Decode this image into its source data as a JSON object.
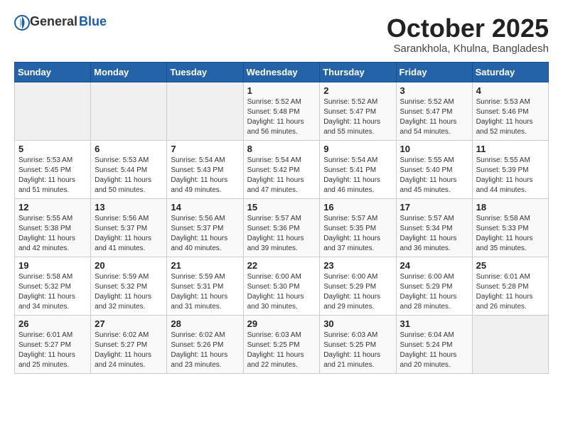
{
  "header": {
    "logo_general": "General",
    "logo_blue": "Blue",
    "month_title": "October 2025",
    "subtitle": "Sarankhola, Khulna, Bangladesh"
  },
  "weekdays": [
    "Sunday",
    "Monday",
    "Tuesday",
    "Wednesday",
    "Thursday",
    "Friday",
    "Saturday"
  ],
  "weeks": [
    [
      {
        "day": "",
        "content": ""
      },
      {
        "day": "",
        "content": ""
      },
      {
        "day": "",
        "content": ""
      },
      {
        "day": "1",
        "content": "Sunrise: 5:52 AM\nSunset: 5:48 PM\nDaylight: 11 hours\nand 56 minutes."
      },
      {
        "day": "2",
        "content": "Sunrise: 5:52 AM\nSunset: 5:47 PM\nDaylight: 11 hours\nand 55 minutes."
      },
      {
        "day": "3",
        "content": "Sunrise: 5:52 AM\nSunset: 5:47 PM\nDaylight: 11 hours\nand 54 minutes."
      },
      {
        "day": "4",
        "content": "Sunrise: 5:53 AM\nSunset: 5:46 PM\nDaylight: 11 hours\nand 52 minutes."
      }
    ],
    [
      {
        "day": "5",
        "content": "Sunrise: 5:53 AM\nSunset: 5:45 PM\nDaylight: 11 hours\nand 51 minutes."
      },
      {
        "day": "6",
        "content": "Sunrise: 5:53 AM\nSunset: 5:44 PM\nDaylight: 11 hours\nand 50 minutes."
      },
      {
        "day": "7",
        "content": "Sunrise: 5:54 AM\nSunset: 5:43 PM\nDaylight: 11 hours\nand 49 minutes."
      },
      {
        "day": "8",
        "content": "Sunrise: 5:54 AM\nSunset: 5:42 PM\nDaylight: 11 hours\nand 47 minutes."
      },
      {
        "day": "9",
        "content": "Sunrise: 5:54 AM\nSunset: 5:41 PM\nDaylight: 11 hours\nand 46 minutes."
      },
      {
        "day": "10",
        "content": "Sunrise: 5:55 AM\nSunset: 5:40 PM\nDaylight: 11 hours\nand 45 minutes."
      },
      {
        "day": "11",
        "content": "Sunrise: 5:55 AM\nSunset: 5:39 PM\nDaylight: 11 hours\nand 44 minutes."
      }
    ],
    [
      {
        "day": "12",
        "content": "Sunrise: 5:55 AM\nSunset: 5:38 PM\nDaylight: 11 hours\nand 42 minutes."
      },
      {
        "day": "13",
        "content": "Sunrise: 5:56 AM\nSunset: 5:37 PM\nDaylight: 11 hours\nand 41 minutes."
      },
      {
        "day": "14",
        "content": "Sunrise: 5:56 AM\nSunset: 5:37 PM\nDaylight: 11 hours\nand 40 minutes."
      },
      {
        "day": "15",
        "content": "Sunrise: 5:57 AM\nSunset: 5:36 PM\nDaylight: 11 hours\nand 39 minutes."
      },
      {
        "day": "16",
        "content": "Sunrise: 5:57 AM\nSunset: 5:35 PM\nDaylight: 11 hours\nand 37 minutes."
      },
      {
        "day": "17",
        "content": "Sunrise: 5:57 AM\nSunset: 5:34 PM\nDaylight: 11 hours\nand 36 minutes."
      },
      {
        "day": "18",
        "content": "Sunrise: 5:58 AM\nSunset: 5:33 PM\nDaylight: 11 hours\nand 35 minutes."
      }
    ],
    [
      {
        "day": "19",
        "content": "Sunrise: 5:58 AM\nSunset: 5:32 PM\nDaylight: 11 hours\nand 34 minutes."
      },
      {
        "day": "20",
        "content": "Sunrise: 5:59 AM\nSunset: 5:32 PM\nDaylight: 11 hours\nand 32 minutes."
      },
      {
        "day": "21",
        "content": "Sunrise: 5:59 AM\nSunset: 5:31 PM\nDaylight: 11 hours\nand 31 minutes."
      },
      {
        "day": "22",
        "content": "Sunrise: 6:00 AM\nSunset: 5:30 PM\nDaylight: 11 hours\nand 30 minutes."
      },
      {
        "day": "23",
        "content": "Sunrise: 6:00 AM\nSunset: 5:29 PM\nDaylight: 11 hours\nand 29 minutes."
      },
      {
        "day": "24",
        "content": "Sunrise: 6:00 AM\nSunset: 5:29 PM\nDaylight: 11 hours\nand 28 minutes."
      },
      {
        "day": "25",
        "content": "Sunrise: 6:01 AM\nSunset: 5:28 PM\nDaylight: 11 hours\nand 26 minutes."
      }
    ],
    [
      {
        "day": "26",
        "content": "Sunrise: 6:01 AM\nSunset: 5:27 PM\nDaylight: 11 hours\nand 25 minutes."
      },
      {
        "day": "27",
        "content": "Sunrise: 6:02 AM\nSunset: 5:27 PM\nDaylight: 11 hours\nand 24 minutes."
      },
      {
        "day": "28",
        "content": "Sunrise: 6:02 AM\nSunset: 5:26 PM\nDaylight: 11 hours\nand 23 minutes."
      },
      {
        "day": "29",
        "content": "Sunrise: 6:03 AM\nSunset: 5:25 PM\nDaylight: 11 hours\nand 22 minutes."
      },
      {
        "day": "30",
        "content": "Sunrise: 6:03 AM\nSunset: 5:25 PM\nDaylight: 11 hours\nand 21 minutes."
      },
      {
        "day": "31",
        "content": "Sunrise: 6:04 AM\nSunset: 5:24 PM\nDaylight: 11 hours\nand 20 minutes."
      },
      {
        "day": "",
        "content": ""
      }
    ]
  ]
}
